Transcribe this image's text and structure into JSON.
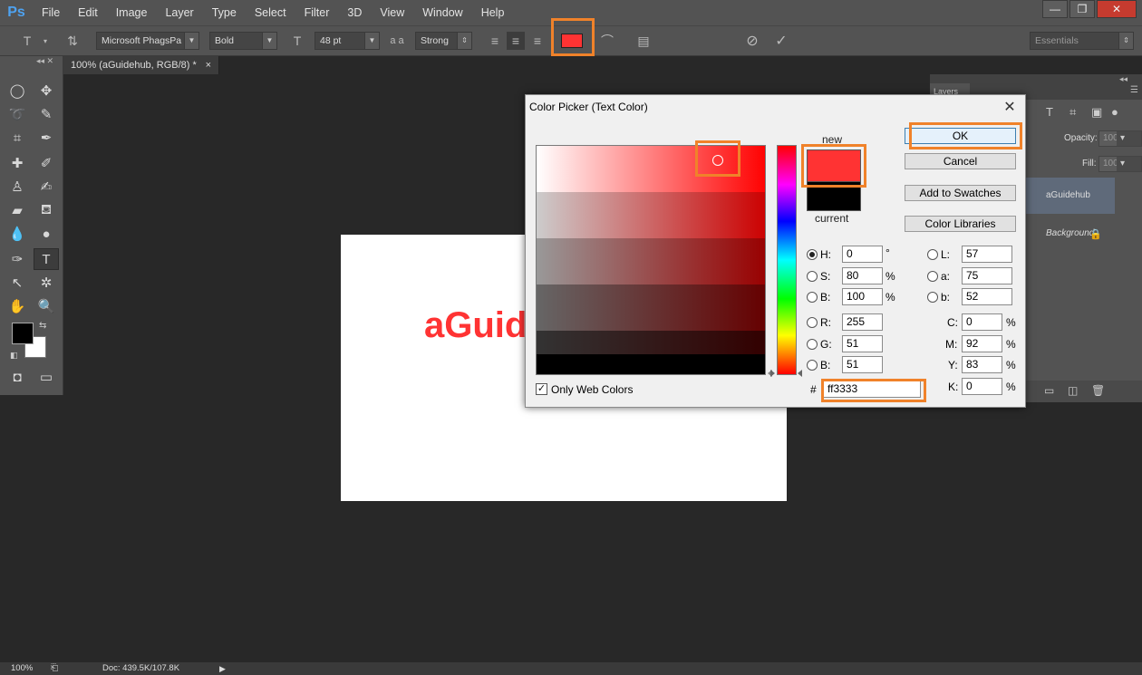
{
  "app": {
    "logo": "Ps",
    "menu": [
      "File",
      "Edit",
      "Image",
      "Layer",
      "Type",
      "Select",
      "Filter",
      "3D",
      "View",
      "Window",
      "Help"
    ],
    "window_controls": [
      "—",
      "❐",
      "✕"
    ]
  },
  "options_bar": {
    "font_family": "Microsoft PhagsPa",
    "font_style": "Bold",
    "font_size": "48 pt",
    "antialias_icon_text": "a a",
    "antialias": "Strong",
    "text_color": "#ff3333",
    "workspace": "Essentials"
  },
  "document": {
    "tab_title": "100% (aGuidehub, RGB/8) *",
    "tab_close": "×",
    "canvas_text": "aGuidehub",
    "text_color": "#ff3333"
  },
  "layers_panel": {
    "tab": "Layers",
    "opacity_label": "Opacity:",
    "opacity_value": "100%",
    "fill_label": "Fill:",
    "fill_value": "100%",
    "layers": [
      {
        "name": "aGuidehub",
        "selected": true
      },
      {
        "name": "Background",
        "locked": true
      }
    ]
  },
  "status_bar": {
    "zoom": "100%",
    "doc": "Doc: 439.5K/107.8K"
  },
  "color_picker": {
    "title": "Color Picker (Text Color)",
    "new_label": "new",
    "current_label": "current",
    "new_color": "#ff3333",
    "current_color": "#000000",
    "buttons": {
      "ok": "OK",
      "cancel": "Cancel",
      "add_swatches": "Add to Swatches",
      "color_libraries": "Color Libraries"
    },
    "hsb": [
      {
        "label": "H:",
        "value": "0",
        "unit": "°",
        "selected": true
      },
      {
        "label": "S:",
        "value": "80",
        "unit": "%"
      },
      {
        "label": "B:",
        "value": "100",
        "unit": "%"
      }
    ],
    "rgb": [
      {
        "label": "R:",
        "value": "255"
      },
      {
        "label": "G:",
        "value": "51"
      },
      {
        "label": "B:",
        "value": "51"
      }
    ],
    "lab": [
      {
        "label": "L:",
        "value": "57"
      },
      {
        "label": "a:",
        "value": "75"
      },
      {
        "label": "b:",
        "value": "52"
      }
    ],
    "cmyk": [
      {
        "label": "C:",
        "value": "0",
        "unit": "%"
      },
      {
        "label": "M:",
        "value": "92",
        "unit": "%"
      },
      {
        "label": "Y:",
        "value": "83",
        "unit": "%"
      },
      {
        "label": "K:",
        "value": "0",
        "unit": "%"
      }
    ],
    "hex_label": "#",
    "hex_value": "ff3333",
    "only_web_colors_label": "Only Web Colors",
    "only_web_colors_checked": true
  },
  "highlight_color": "#f0822a"
}
